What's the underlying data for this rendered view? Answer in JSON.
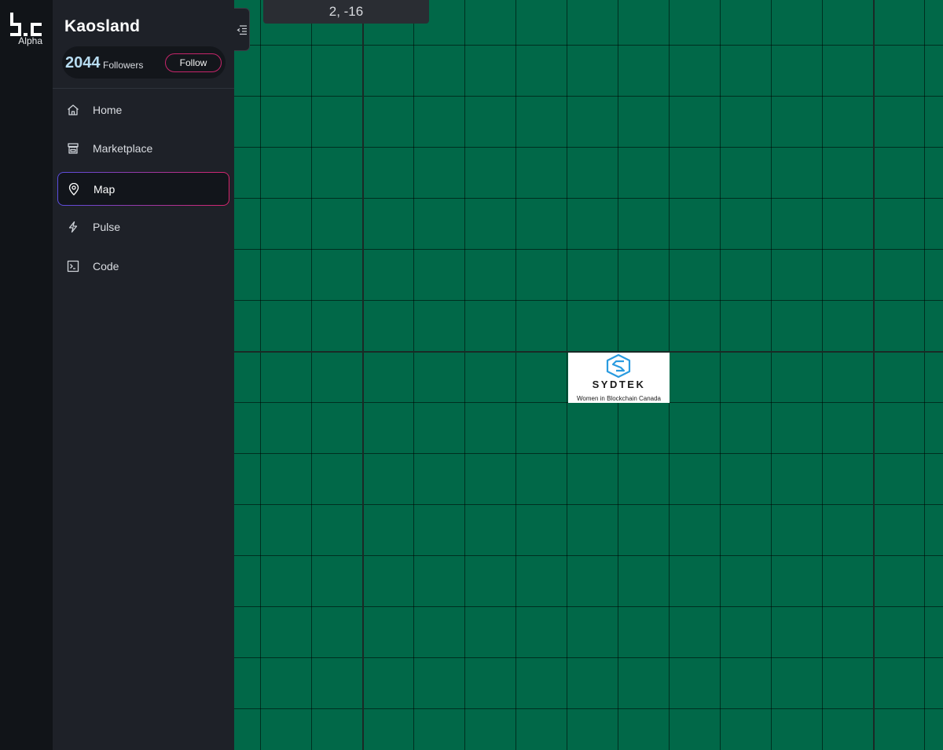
{
  "brand": {
    "logo_icon": "bc-logo-icon",
    "tag": "Alpha"
  },
  "space": {
    "title": "Kaosland",
    "followers_count": "2044",
    "followers_label": "Followers",
    "follow_label": "Follow"
  },
  "nav": {
    "items": [
      {
        "label": "Home",
        "icon": "home-icon"
      },
      {
        "label": "Marketplace",
        "icon": "store-icon"
      },
      {
        "label": "Map",
        "icon": "map-pin-icon",
        "active": true
      },
      {
        "label": "Pulse",
        "icon": "lightning-icon"
      },
      {
        "label": "Code",
        "icon": "terminal-icon"
      }
    ]
  },
  "map": {
    "coordinates": "2, -16",
    "collapse_icon": "collapse-menu-icon",
    "tile": {
      "name": "SYDTEK",
      "tagline": "Women in Blockchain Canada",
      "logo_icon": "sydtek-logo-icon"
    }
  },
  "colors": {
    "map_green": "#016848",
    "sidebar": "#1e2128",
    "rail": "#111418",
    "accent_pink": "#c7256b",
    "accent_purple": "#5b4de0",
    "followers_blue": "#b7dcf1"
  }
}
